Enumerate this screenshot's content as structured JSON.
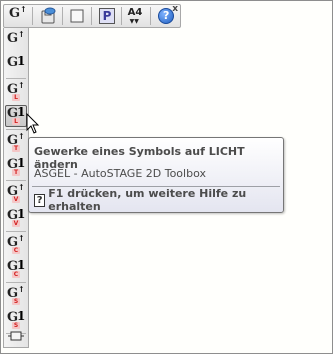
{
  "top_toolbar": {
    "buttons": [
      {
        "name": "gewerk-g-up",
        "icon": "g-up-arrow-icon",
        "label": "G"
      },
      {
        "name": "cloud-save",
        "icon": "cloud-save-icon"
      },
      {
        "name": "blank-sheet",
        "icon": "blank-sheet-icon"
      },
      {
        "name": "p-button",
        "icon": "p-letter-icon",
        "label": "P"
      },
      {
        "name": "paper-size",
        "icon": "paper-a4-icon",
        "label": "A4"
      },
      {
        "name": "help",
        "icon": "help-icon",
        "label": "?"
      }
    ],
    "close_label": "x"
  },
  "tools": [
    {
      "name": "tool-g-up",
      "letter": "G",
      "sub": "↑",
      "badge": ""
    },
    {
      "name": "tool-g-1",
      "letter": "G",
      "sub": "1",
      "badge": ""
    },
    {
      "name": "tool-g-up-l",
      "letter": "G",
      "sub": "↑",
      "badge": "L"
    },
    {
      "name": "tool-g-1-l",
      "letter": "G",
      "sub": "1",
      "badge": "L"
    },
    {
      "name": "tool-g-up-t",
      "letter": "G",
      "sub": "↑",
      "badge": "T"
    },
    {
      "name": "tool-g-1-t",
      "letter": "G",
      "sub": "1",
      "badge": "T"
    },
    {
      "name": "tool-g-up-v",
      "letter": "G",
      "sub": "↑",
      "badge": "V"
    },
    {
      "name": "tool-g-1-v",
      "letter": "G",
      "sub": "1",
      "badge": "V"
    },
    {
      "name": "tool-g-up-c",
      "letter": "G",
      "sub": "↑",
      "badge": "C"
    },
    {
      "name": "tool-g-1-c",
      "letter": "G",
      "sub": "1",
      "badge": "C"
    },
    {
      "name": "tool-g-up-s",
      "letter": "G",
      "sub": "↑",
      "badge": "S"
    },
    {
      "name": "tool-g-1-s",
      "letter": "G",
      "sub": "1",
      "badge": "S"
    },
    {
      "name": "tool-dock",
      "icon": "dock-icon"
    }
  ],
  "tooltip": {
    "title": "Gewerke eines Symbols auf LICHT ändern",
    "description": "ASGEL - AutoSTAGE 2D Toolbox",
    "help_icon": "?",
    "help_text": "F1 drücken, um weitere Hilfe zu erhalten"
  },
  "colors": {
    "badge_red": "#d32020",
    "badge_bg": "#f4c7c7",
    "help_blue": "#1f5fbf",
    "p_purple": "#3a3a9a"
  }
}
